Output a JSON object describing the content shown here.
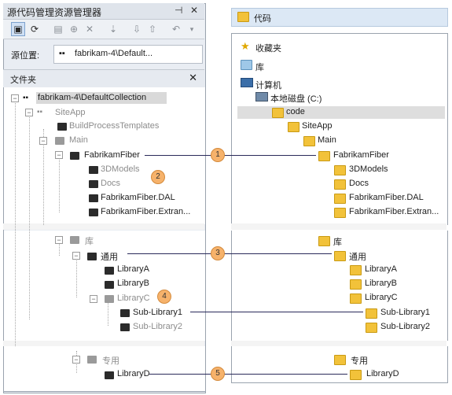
{
  "left_panel": {
    "title": "源代码管理资源管理器",
    "pin_glyph": "⊣",
    "close_glyph": "✕",
    "source_label": "源位置:",
    "source_value": "fabrikam-4\\Default...",
    "folders_header": "文件夹",
    "folders_close": "✕"
  },
  "tree": {
    "root": "fabrikam-4\\DefaultCollection",
    "siteapp": "SiteApp",
    "bpt": "BuildProcessTemplates",
    "main": "Main",
    "fabrikamfiber": "FabrikamFiber",
    "models": "3DModels",
    "docs": "Docs",
    "dal": "FabrikamFiber.DAL",
    "extran": "FabrikamFiber.Extran...",
    "ku": "库",
    "tongyong": "通用",
    "liba": "LibraryA",
    "libb": "LibraryB",
    "libc": "LibraryC",
    "sub1": "Sub-Library1",
    "sub2": "Sub-Library2",
    "zhuanyong": "专用",
    "libd": "LibraryD"
  },
  "right_panel": {
    "title": "代码",
    "favorites": "收藏夹",
    "library": "库",
    "computer": "计算机",
    "local_disk": "本地磁盘 (C:)",
    "code": "code",
    "siteapp": "SiteApp",
    "main": "Main",
    "fabrikamfiber": "FabrikamFiber",
    "models": "3DModels",
    "docs": "Docs",
    "dal": "FabrikamFiber.DAL",
    "extran": "FabrikamFiber.Extran...",
    "ku": "库",
    "tongyong": "通用",
    "liba": "LibraryA",
    "libb": "LibraryB",
    "libc": "LibraryC",
    "sub1": "Sub-Library1",
    "sub2": "Sub-Library2",
    "zhuanyong": "专用",
    "libd": "LibraryD"
  },
  "callouts": [
    "1",
    "2",
    "3",
    "4",
    "5"
  ],
  "colors": {
    "panel_bg": "#e9edf3",
    "callout": "#f6b26b",
    "folder_yellow": "#f2c23a",
    "connector": "#2a2a5a"
  }
}
